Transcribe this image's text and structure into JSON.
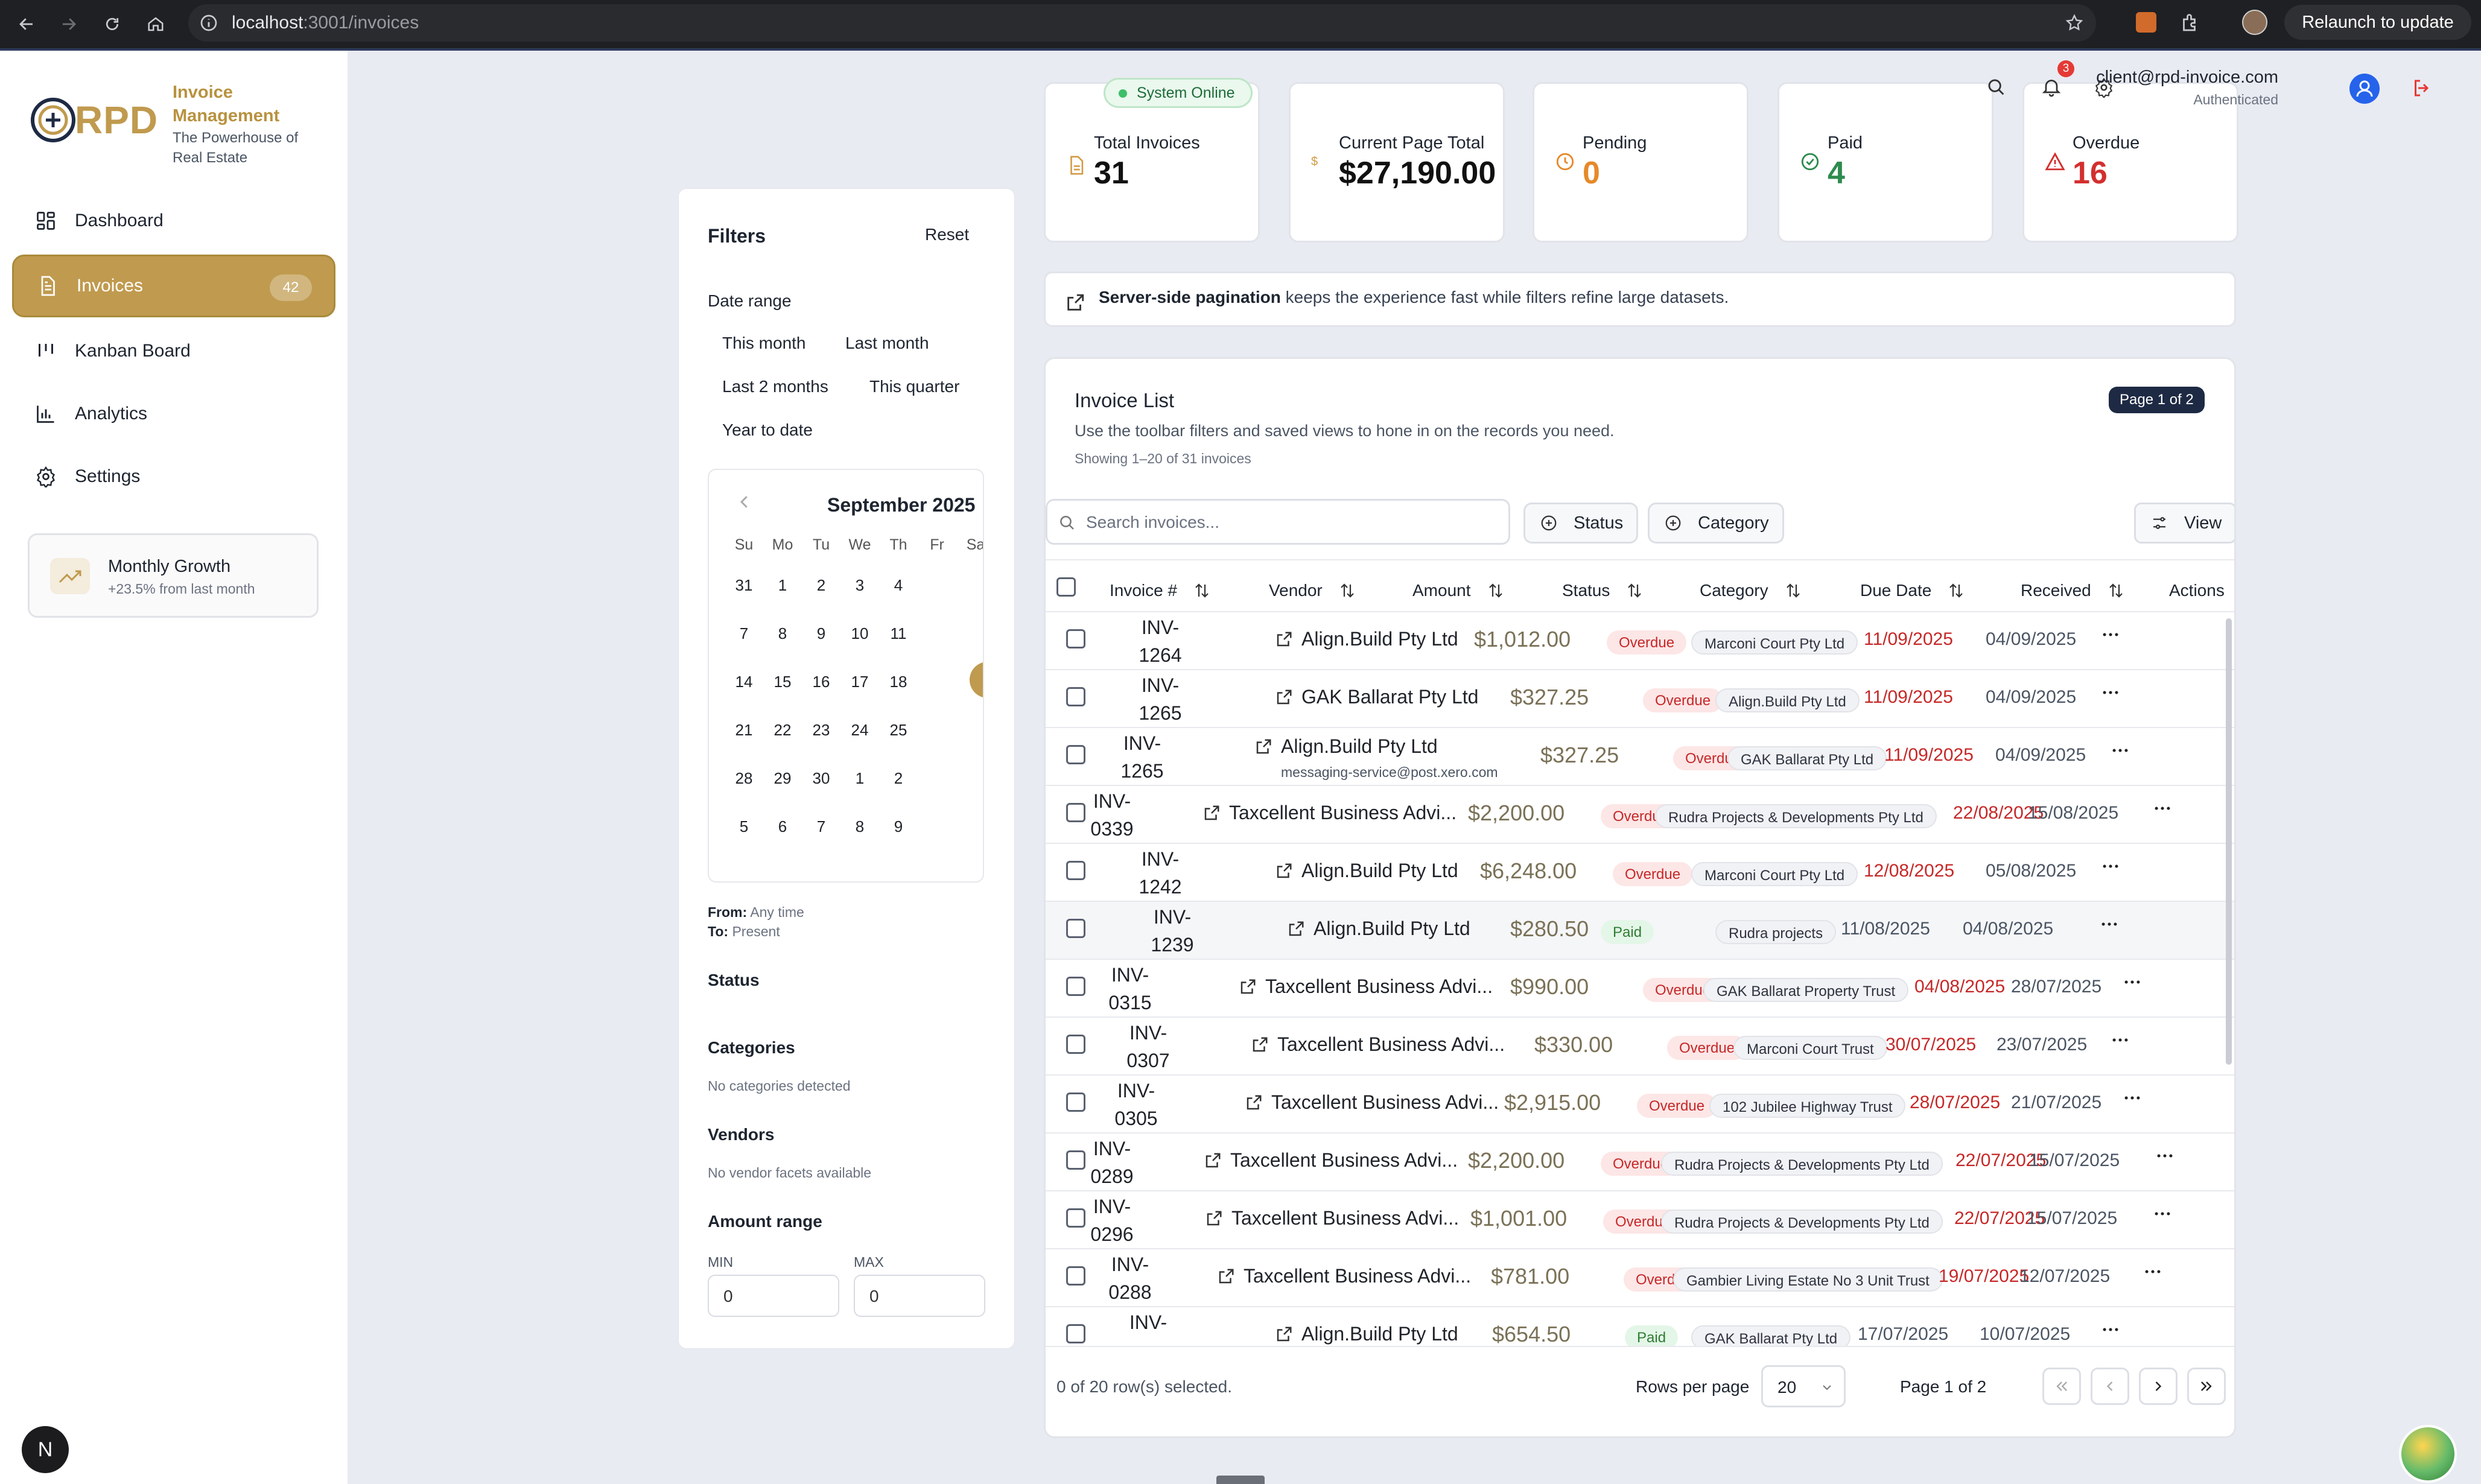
{
  "browser": {
    "url_host": "localhost",
    "url_path": ":3001/invoices",
    "relaunch_label": "Relaunch to update"
  },
  "brand": {
    "logo_text": "RPD",
    "title_line1": "Invoice",
    "title_line2": "Management",
    "tagline_line1": "The Powerhouse of",
    "tagline_line2": "Real Estate"
  },
  "sidebar": {
    "items": [
      {
        "label": "Dashboard",
        "icon": "grid-icon"
      },
      {
        "label": "Invoices",
        "icon": "document-icon",
        "badge": "42",
        "active": true
      },
      {
        "label": "Kanban Board",
        "icon": "kanban-icon"
      },
      {
        "label": "Analytics",
        "icon": "bar-chart-icon"
      },
      {
        "label": "Settings",
        "icon": "gear-icon"
      }
    ],
    "growth": {
      "title": "Monthly Growth",
      "subtitle": "+23.5% from last month"
    }
  },
  "header": {
    "system_status": "System Online",
    "notifications_count": "3",
    "user_email": "client@rpd-invoice.com",
    "user_status": "Authenticated"
  },
  "stats": [
    {
      "label": "Total Invoices",
      "value": "31",
      "color": "#111111"
    },
    {
      "label": "Current Page Total",
      "value": "$27,190.00",
      "color": "#111111"
    },
    {
      "label": "Pending",
      "value": "0",
      "color": "#e6892a"
    },
    {
      "label": "Paid",
      "value": "4",
      "color": "#2e8b4e"
    },
    {
      "label": "Overdue",
      "value": "16",
      "color": "#d32f2f"
    }
  ],
  "info_banner": {
    "bold": "Server-side pagination",
    "rest": " keeps the experience fast while filters refine large datasets."
  },
  "filters": {
    "title": "Filters",
    "reset": "Reset",
    "date_range_label": "Date range",
    "presets": [
      "This month",
      "Last month",
      "Last 2 months",
      "This quarter",
      "Year to date"
    ],
    "calendar": {
      "month": "September 2025",
      "weekdays": [
        "Su",
        "Mo",
        "Tu",
        "We",
        "Th",
        "Fr",
        "Sa"
      ],
      "weeks": [
        [
          "31",
          "1",
          "2",
          "3",
          "4"
        ],
        [
          "7",
          "8",
          "9",
          "10",
          "11"
        ],
        [
          "14",
          "15",
          "16",
          "17",
          "18"
        ],
        [
          "21",
          "22",
          "23",
          "24",
          "25"
        ],
        [
          "28",
          "29",
          "30",
          "1",
          "2"
        ],
        [
          "5",
          "6",
          "7",
          "8",
          "9"
        ]
      ]
    },
    "from_label": "From:",
    "from_value": "Any time",
    "to_label": "To:",
    "to_value": "Present",
    "status_label": "Status",
    "categories_label": "Categories",
    "categories_empty": "No categories detected",
    "vendors_label": "Vendors",
    "vendors_empty": "No vendor facets available",
    "amount_label": "Amount range",
    "min_label": "MIN",
    "max_label": "MAX",
    "min_value": "0",
    "max_value": "0"
  },
  "invoice_list": {
    "title": "Invoice List",
    "page_badge": "Page 1 of 2",
    "subtitle": "Use the toolbar filters and saved views to hone in on the records you need.",
    "showing": "Showing 1–20 of 31 invoices",
    "search_placeholder": "Search invoices...",
    "status_filter": "Status",
    "category_filter": "Category",
    "view_button": "View",
    "columns": [
      "Invoice #",
      "Vendor",
      "Amount",
      "Status",
      "Category",
      "Due Date",
      "Received",
      "Actions"
    ],
    "rows": [
      {
        "inv1": "INV-",
        "inv2": "1264",
        "vendor": "Align.Build Pty Ltd",
        "sub": "",
        "amount": "$1,012.00",
        "status": "Overdue",
        "category": "Marconi Court Pty Ltd",
        "due": "11/09/2025",
        "due_red": true,
        "received": "04/09/2025"
      },
      {
        "inv1": "INV-",
        "inv2": "1265",
        "vendor": "GAK Ballarat Pty Ltd",
        "sub": "",
        "amount": "$327.25",
        "status": "Overdue",
        "category": "Align.Build Pty Ltd",
        "due": "11/09/2025",
        "due_red": true,
        "received": "04/09/2025"
      },
      {
        "inv1": "INV-",
        "inv2": "1265",
        "vendor": "Align.Build Pty Ltd",
        "sub": "messaging-service@post.xero.com",
        "amount": "$327.25",
        "status": "Overdue",
        "category": "GAK Ballarat Pty Ltd",
        "due": "11/09/2025",
        "due_red": true,
        "received": "04/09/2025"
      },
      {
        "inv1": "INV-",
        "inv2": "0339",
        "vendor": "Taxcellent Business Advi...",
        "sub": "",
        "amount": "$2,200.00",
        "status": "Overdue",
        "category": "Rudra Projects & Developments Pty Ltd",
        "due": "22/08/2025",
        "due_red": true,
        "received": "15/08/2025"
      },
      {
        "inv1": "INV-",
        "inv2": "1242",
        "vendor": "Align.Build Pty Ltd",
        "sub": "",
        "amount": "$6,248.00",
        "status": "Overdue",
        "category": "Marconi Court Pty Ltd",
        "due": "12/08/2025",
        "due_red": true,
        "received": "05/08/2025"
      },
      {
        "inv1": "INV-",
        "inv2": "1239",
        "vendor": "Align.Build Pty Ltd",
        "sub": "",
        "amount": "$280.50",
        "status": "Paid",
        "category": "Rudra projects",
        "due": "11/08/2025",
        "due_red": false,
        "received": "04/08/2025"
      },
      {
        "inv1": "INV-",
        "inv2": "0315",
        "vendor": "Taxcellent Business Advi...",
        "sub": "",
        "amount": "$990.00",
        "status": "Overdue",
        "category": "GAK Ballarat Property Trust",
        "due": "04/08/2025",
        "due_red": true,
        "received": "28/07/2025"
      },
      {
        "inv1": "INV-",
        "inv2": "0307",
        "vendor": "Taxcellent Business Advi...",
        "sub": "",
        "amount": "$330.00",
        "status": "Overdue",
        "category": "Marconi Court Trust",
        "due": "30/07/2025",
        "due_red": true,
        "received": "23/07/2025"
      },
      {
        "inv1": "INV-",
        "inv2": "0305",
        "vendor": "Taxcellent Business Advi...",
        "sub": "",
        "amount": "$2,915.00",
        "status": "Overdue",
        "category": "102 Jubilee Highway Trust",
        "due": "28/07/2025",
        "due_red": true,
        "received": "21/07/2025"
      },
      {
        "inv1": "INV-",
        "inv2": "0289",
        "vendor": "Taxcellent Business Advi...",
        "sub": "",
        "amount": "$2,200.00",
        "status": "Overdue",
        "category": "Rudra Projects & Developments Pty Ltd",
        "due": "22/07/2025",
        "due_red": true,
        "received": "15/07/2025"
      },
      {
        "inv1": "INV-",
        "inv2": "0296",
        "vendor": "Taxcellent Business Advi...",
        "sub": "",
        "amount": "$1,001.00",
        "status": "Overdue",
        "category": "Rudra Projects & Developments Pty Ltd",
        "due": "22/07/2025",
        "due_red": true,
        "received": "15/07/2025"
      },
      {
        "inv1": "INV-",
        "inv2": "0288",
        "vendor": "Taxcellent Business Advi...",
        "sub": "",
        "amount": "$781.00",
        "status": "Overdue",
        "category": "Gambier Living Estate No 3 Unit Trust",
        "due": "19/07/2025",
        "due_red": true,
        "received": "12/07/2025"
      },
      {
        "inv1": "INV-",
        "inv2": "",
        "vendor": "Align.Build Pty Ltd",
        "sub": "",
        "amount": "$654.50",
        "status": "Paid",
        "category": "GAK Ballarat Pty Ltd",
        "due": "17/07/2025",
        "due_red": false,
        "received": "10/07/2025"
      }
    ],
    "selected_text": "0 of 20 row(s) selected.",
    "rows_per_page_label": "Rows per page",
    "rows_per_page_value": "20",
    "page_text": "Page 1 of 2"
  },
  "corner_badge": "N",
  "colors": {
    "accent_gold": "#c09a4e",
    "overdue_red": "#c62828",
    "paid_green": "#2e7d32",
    "navy": "#1e2a44"
  }
}
